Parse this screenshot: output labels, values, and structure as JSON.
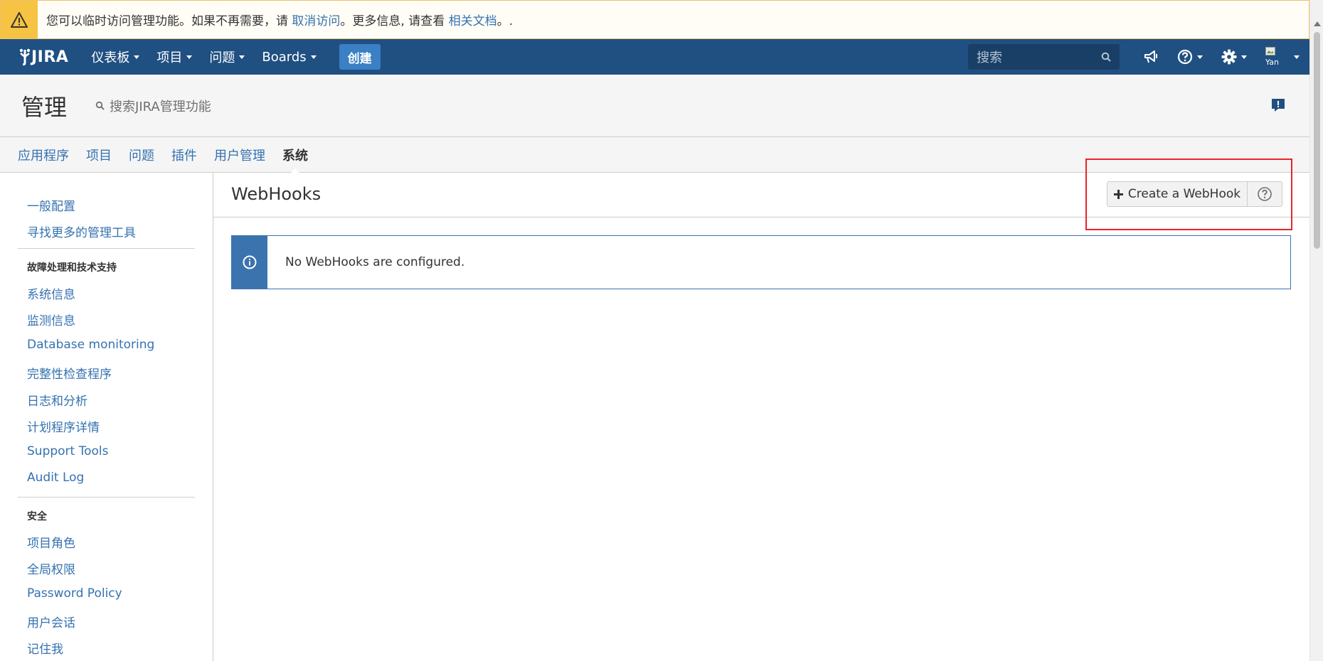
{
  "banner": {
    "text_before": "您可以临时访问管理功能。如果不再需要，请 ",
    "link_revoke": "取消访问",
    "text_middle": "。更多信息, 请查看 ",
    "link_docs": "相关文档",
    "text_after": "。.",
    "icon": "warning-icon"
  },
  "nav": {
    "logo": "JIRA",
    "items": [
      "仪表板",
      "项目",
      "问题",
      "Boards"
    ],
    "create_label": "创建",
    "search_placeholder": "搜索",
    "avatar_text": "Yan"
  },
  "admin": {
    "title": "管理",
    "search_placeholder": "搜索JIRA管理功能",
    "tabs": [
      "应用程序",
      "项目",
      "问题",
      "插件",
      "用户管理",
      "系统"
    ],
    "active_tab": "系统"
  },
  "sidebar": {
    "group1": [
      "一般配置",
      "寻找更多的管理工具"
    ],
    "heading2": "故障处理和技术支持",
    "group2": [
      "系统信息",
      "监测信息",
      "Database monitoring",
      "完整性检查程序",
      "日志和分析",
      "计划程序详情",
      "Support Tools",
      "Audit Log"
    ],
    "heading3": "安全",
    "group3": [
      "项目角色",
      "全局权限",
      "Password Policy",
      "用户会话",
      "记住我"
    ]
  },
  "main": {
    "title": "WebHooks",
    "create_button": "Create a WebHook",
    "info_message": "No WebHooks are configured."
  },
  "colors": {
    "nav_bg": "#205081",
    "link": "#3572b0",
    "highlight": "#e8242a",
    "info": "#3b73af",
    "warning": "#f6c342"
  }
}
